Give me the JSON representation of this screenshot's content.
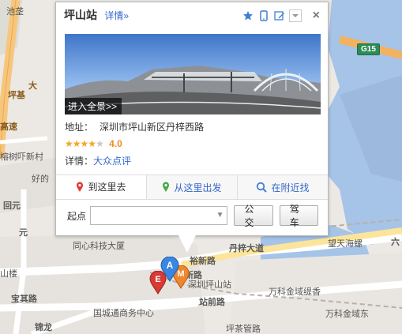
{
  "map": {
    "labels": {
      "chi_shui": "池垄",
      "pingji": "坪基",
      "da_wu": "大",
      "gaosu": "高速",
      "bangnong": "榕树吓新村",
      "haode": "好的",
      "hui_yuan": "回元",
      "yuan": "元",
      "tongxin": "同心科技大厦",
      "baoqi": "宝其路",
      "guocheng": "国城通商务中心",
      "jinlong": "锦龙",
      "wanke1": "万科金域缇香",
      "wanke2": "万科金域东",
      "wangtian": "望天海螺",
      "pingshan_station_map": "深圳坪山站",
      "yu_xin": "裕新路",
      "danzi": "丹梓大道",
      "zhanqian": "站前路",
      "shanlou": "山楼",
      "xinlu": "新路",
      "g15": "G15",
      "liu": "六",
      "bottom_cut": "坪茶管路"
    },
    "markers": {
      "a": "A",
      "e": "E",
      "m": "M"
    }
  },
  "popup": {
    "title": "坪山站",
    "details_link": "详情»",
    "tool_icons": [
      "star-icon",
      "phone-icon",
      "edit-icon",
      "dropdown-icon"
    ],
    "close_icon": "×",
    "panorama_button": "进入全景>>",
    "address_label": "地址：",
    "address_value": "深圳市坪山新区丹梓西路",
    "rating_value": "4.0",
    "rating_fraction": 0.8,
    "details_label": "详情：",
    "dianping_link": "大众点评",
    "tabs": [
      {
        "label": "到这里去",
        "icon": "red-pin-icon"
      },
      {
        "label": "从这里出发",
        "icon": "green-pin-icon"
      },
      {
        "label": "在附近找",
        "icon": "search-icon"
      }
    ],
    "start_label": "起点",
    "start_value": "",
    "bus_button": "公交",
    "drive_button": "驾车"
  }
}
